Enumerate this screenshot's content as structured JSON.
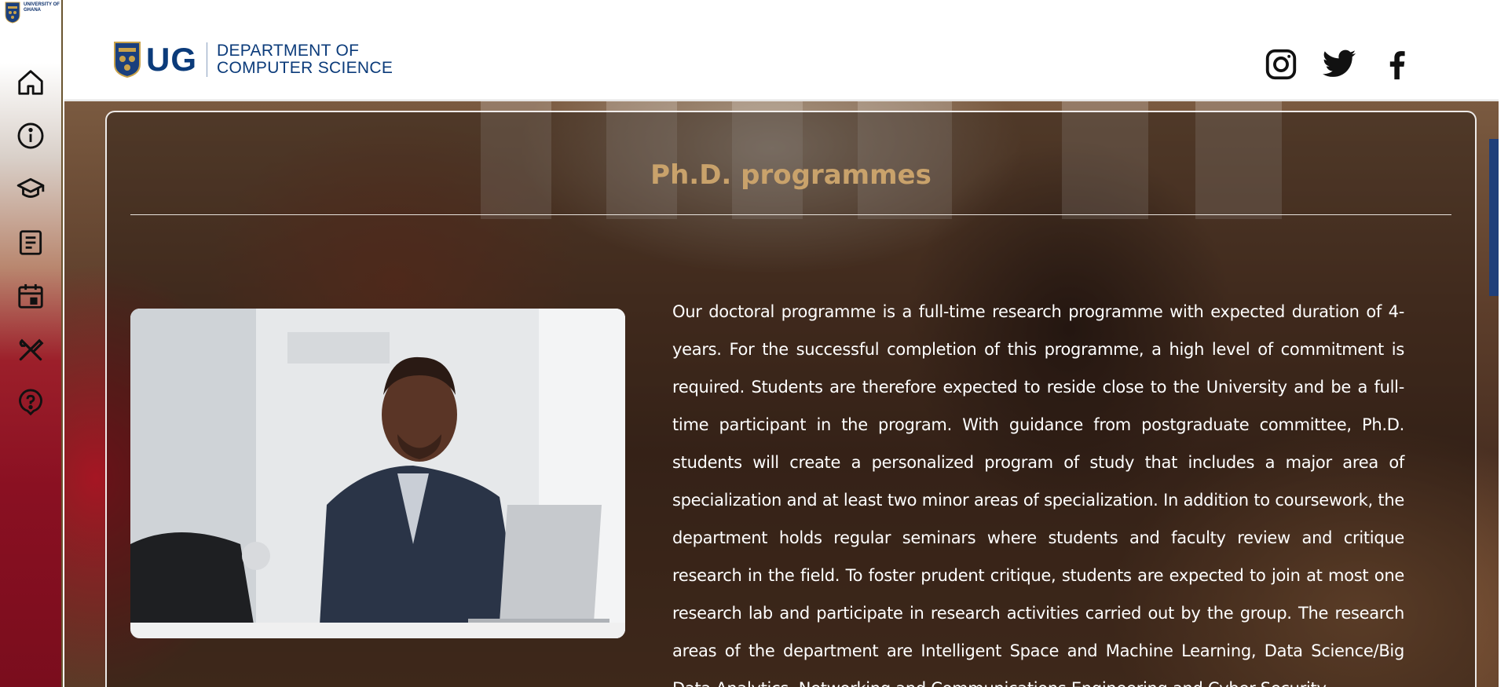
{
  "sidebar": {
    "logo_text": "UNIVERSITY OF GHANA",
    "items": [
      {
        "name": "home",
        "icon": "home-icon"
      },
      {
        "name": "about",
        "icon": "info-icon"
      },
      {
        "name": "academics",
        "icon": "graduation-cap-icon"
      },
      {
        "name": "news",
        "icon": "article-icon"
      },
      {
        "name": "events",
        "icon": "calendar-icon"
      },
      {
        "name": "facilities",
        "icon": "tools-icon"
      },
      {
        "name": "help",
        "icon": "help-icon"
      }
    ]
  },
  "header": {
    "brand_short": "UG",
    "dept_line1": "DEPARTMENT OF",
    "dept_line2": "COMPUTER SCIENCE",
    "social": [
      "instagram-icon",
      "twitter-icon",
      "facebook-icon"
    ]
  },
  "content": {
    "title": "Ph.D. programmes",
    "description": "Our doctoral programme is a full-time research programme with expected duration of 4-years. For the successful completion of this programme, a high level of commitment is required. Students are therefore expected to reside close to the University and be a full-time participant in the program. With guidance from postgraduate committee, Ph.D. students will create a personalized program of study that includes a major area of specialization and at least two minor areas of specialization. In addition to coursework, the department holds regular seminars where students and faculty review and critique research in the field. To foster prudent critique, students are expected to join at most one research lab and participate in research activities carried out by the group. The research areas of the department are Intelligent Space and Machine Learning, Data Science/Big Data Analytics, Networking and Communications Engineering and Cyber Security."
  },
  "colors": {
    "brand_blue": "#0b3b7a",
    "title_gold": "#c9a26b",
    "sidebar_red": "#8a1022"
  }
}
